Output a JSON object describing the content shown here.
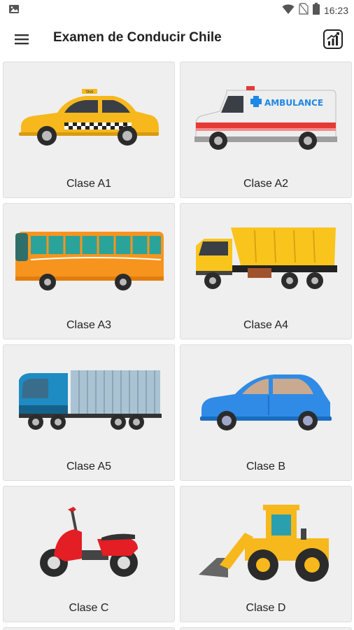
{
  "status_bar": {
    "time": "16:23",
    "icons": [
      "image-icon",
      "wifi-icon",
      "no-sim-icon",
      "battery-icon"
    ]
  },
  "app_bar": {
    "title": "Examen de Conducir Chile",
    "icons": [
      "menu-icon",
      "stats-chart-icon"
    ]
  },
  "categories": [
    {
      "label": "Clase A1",
      "icon": "taxi-icon",
      "color": "#F6B81C"
    },
    {
      "label": "Clase A2",
      "icon": "ambulance-icon",
      "color": "#E53935"
    },
    {
      "label": "Clase A3",
      "icon": "bus-icon",
      "color": "#F7941D"
    },
    {
      "label": "Clase A4",
      "icon": "dump-truck-icon",
      "color": "#F9C51D"
    },
    {
      "label": "Clase A5",
      "icon": "container-truck-icon",
      "color": "#1E8BC3"
    },
    {
      "label": "Clase B",
      "icon": "car-icon",
      "color": "#2F8BE6"
    },
    {
      "label": "Clase C",
      "icon": "motorcycle-icon",
      "color": "#E31E24"
    },
    {
      "label": "Clase D",
      "icon": "loader-tractor-icon",
      "color": "#F6B81C"
    }
  ],
  "text": {
    "ambulance_decal": "AMBULANCE",
    "taxi_sign": "TAXI"
  }
}
